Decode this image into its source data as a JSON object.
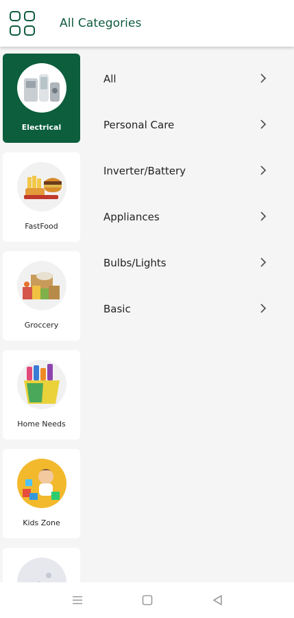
{
  "header": {
    "title": "All Categories",
    "icon": "grid-icon",
    "accent_color": "#0d5a3c"
  },
  "sidebar": {
    "selected_color": "#0c5e3d",
    "categories": [
      {
        "label": "Electrical",
        "icon": "appliances-image",
        "selected": true
      },
      {
        "label": "FastFood",
        "icon": "burger-image",
        "selected": false
      },
      {
        "label": "Groccery",
        "icon": "grocery-image",
        "selected": false
      },
      {
        "label": "Home Needs",
        "icon": "cleaning-basket-image",
        "selected": false
      },
      {
        "label": "Kids Zone",
        "icon": "kids-toys-image",
        "selected": false
      },
      {
        "label": "",
        "icon": "placeholder-image",
        "selected": false
      }
    ]
  },
  "subcategories": [
    {
      "label": "All",
      "icon": "chevron-right-icon"
    },
    {
      "label": "Personal Care",
      "icon": "chevron-right-icon"
    },
    {
      "label": "Inverter/Battery",
      "icon": "chevron-right-icon"
    },
    {
      "label": "Appliances",
      "icon": "chevron-right-icon"
    },
    {
      "label": "Bulbs/Lights",
      "icon": "chevron-right-icon"
    },
    {
      "label": "Basic",
      "icon": "chevron-right-icon"
    }
  ],
  "system_nav": {
    "buttons": [
      "menu-icon",
      "home-square-icon",
      "back-triangle-icon"
    ]
  }
}
